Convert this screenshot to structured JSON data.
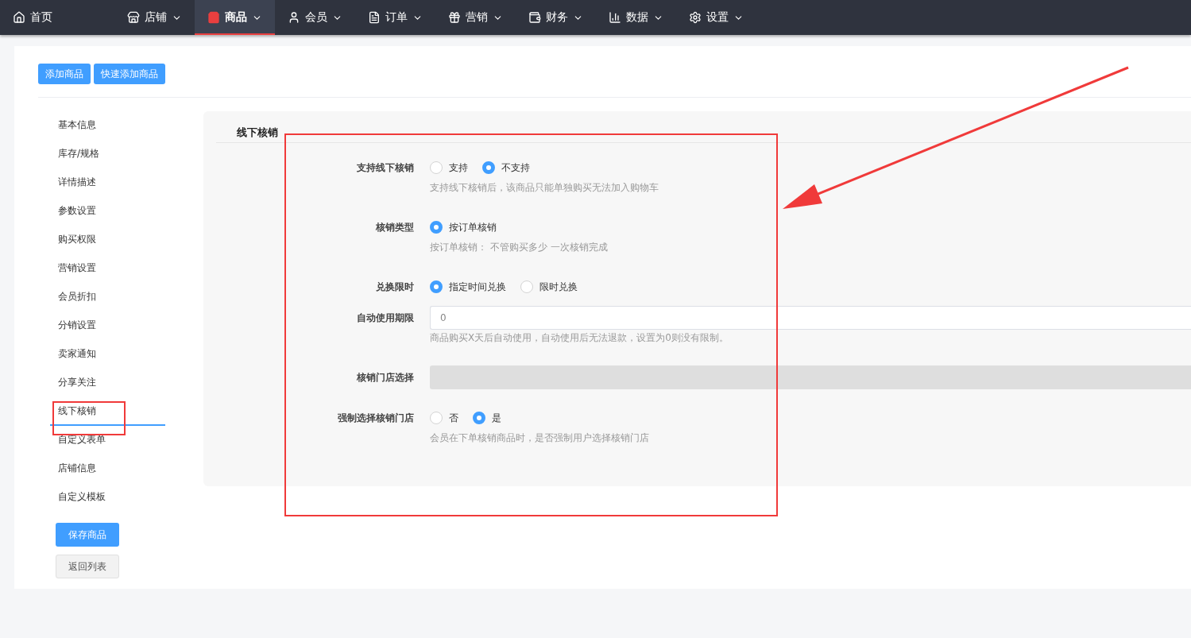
{
  "nav": [
    {
      "label": "首页",
      "selected": false,
      "dropdown": false
    },
    {
      "label": "店铺",
      "selected": false,
      "dropdown": true
    },
    {
      "label": "商品",
      "selected": true,
      "dropdown": true
    },
    {
      "label": "会员",
      "selected": false,
      "dropdown": true
    },
    {
      "label": "订单",
      "selected": false,
      "dropdown": true
    },
    {
      "label": "营销",
      "selected": false,
      "dropdown": true
    },
    {
      "label": "财务",
      "selected": false,
      "dropdown": true
    },
    {
      "label": "数据",
      "selected": false,
      "dropdown": true
    },
    {
      "label": "设置",
      "selected": false,
      "dropdown": true
    }
  ],
  "toolbar": [
    "添加商品",
    "快速添加商品"
  ],
  "sidebar": {
    "items": [
      {
        "label": "基本信息",
        "selected": false
      },
      {
        "label": "库存/规格",
        "selected": false
      },
      {
        "label": "详情描述",
        "selected": false
      },
      {
        "label": "参数设置",
        "selected": false
      },
      {
        "label": "购买权限",
        "selected": false
      },
      {
        "label": "营销设置",
        "selected": false
      },
      {
        "label": "会员折扣",
        "selected": false
      },
      {
        "label": "分销设置",
        "selected": false
      },
      {
        "label": "卖家通知",
        "selected": false
      },
      {
        "label": "分享关注",
        "selected": false
      },
      {
        "label": "线下核销",
        "selected": true
      },
      {
        "label": "自定义表单",
        "selected": false
      },
      {
        "label": "店铺信息",
        "selected": false
      },
      {
        "label": "自定义模板",
        "selected": false
      }
    ],
    "save": "保存商品",
    "back": "返回列表"
  },
  "section": {
    "title": "线下核销",
    "fields": [
      {
        "kind": "radio",
        "label": "支持线下核销",
        "options": [
          {
            "label": "支持",
            "selected": false
          },
          {
            "label": "不支持",
            "selected": true
          }
        ],
        "hint": "支持线下核销后，该商品只能单独购买无法加入购物车"
      },
      {
        "kind": "radio",
        "label": "核销类型",
        "options": [
          {
            "label": "按订单核销",
            "selected": true
          }
        ],
        "hint": "按订单核销： 不管购买多少 一次核销完成"
      },
      {
        "kind": "radio",
        "label": "兑换限时",
        "options": [
          {
            "label": "指定时间兑换",
            "selected": true
          },
          {
            "label": "限时兑换",
            "selected": false
          }
        ]
      },
      {
        "kind": "input",
        "label": "自动使用期限",
        "value": "0",
        "hint": "商品购买X天后自动使用，自动使用后无法退款，设置为0则没有限制。"
      },
      {
        "kind": "select",
        "label": "核销门店选择",
        "disabled": true
      },
      {
        "kind": "radio",
        "label": "强制选择核销门店",
        "options": [
          {
            "label": "否",
            "selected": false
          },
          {
            "label": "是",
            "selected": true
          }
        ],
        "hint": "会员在下单核销商品时，是否强制用户选择核销门店"
      }
    ]
  }
}
